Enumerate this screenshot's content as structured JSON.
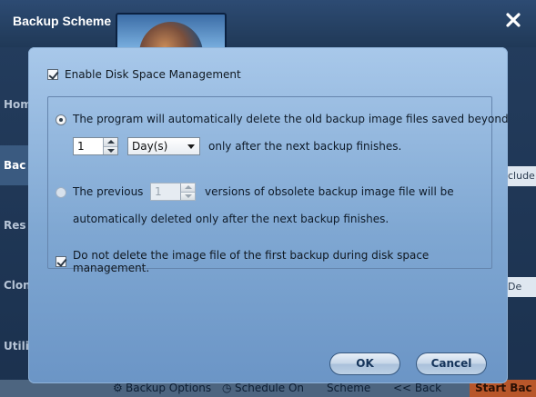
{
  "window": {
    "title": "Backup Scheme"
  },
  "background": {
    "sidebar": [
      "Hom",
      "Bac",
      "Res",
      "Clon",
      "Utili"
    ],
    "right_peeks": [
      "clude",
      "De"
    ],
    "bottom_bar": {
      "backup_options": "Backup Options",
      "schedule": "Schedule On",
      "scheme": "Scheme",
      "back": "<< Back",
      "start": "Start Bac"
    }
  },
  "dialog": {
    "enable_label": "Enable Disk Space Management",
    "option_days": {
      "text": "The program will automatically delete the old backup image files saved beyond",
      "value": "1",
      "unit": "Day(s)",
      "suffix": "only after the next backup finishes."
    },
    "option_versions": {
      "prefix": "The previous",
      "value": "1",
      "suffix": "versions of obsolete backup image file will be",
      "line2": "automatically deleted only after the next backup finishes."
    },
    "keep_first_label": "Do not delete the image file of the first backup during disk space management.",
    "ok_label": "OK",
    "cancel_label": "Cancel"
  },
  "colors": {
    "dialog_top": "#a8c8ea",
    "dialog_bottom": "#6b95c6",
    "button_text": "#15345a",
    "start_button": "#b8562a"
  }
}
